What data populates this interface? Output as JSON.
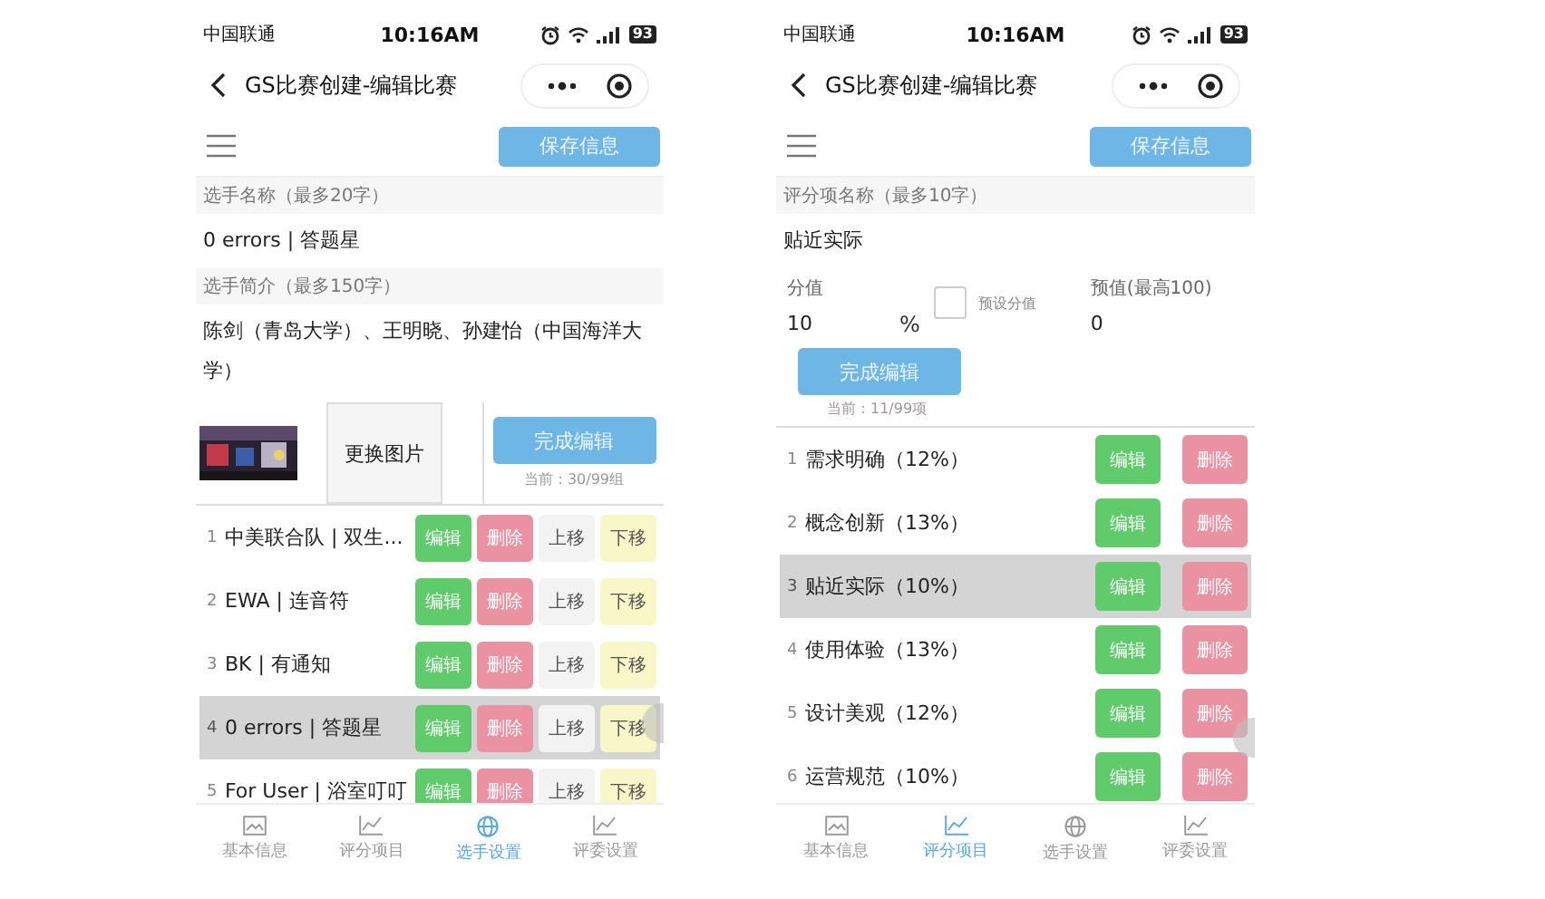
{
  "phones": [
    {
      "status": {
        "carrier": "中国联通",
        "time": "10:16AM",
        "battery": "93"
      },
      "title": "GS比赛创建-编辑比赛",
      "save_label": "保存信息",
      "form": [
        {
          "kind": "field",
          "label": "选手名称（最多20字）",
          "value": "0 errors | 答题星"
        },
        {
          "kind": "field",
          "label": "选手简介（最多150字）",
          "value": "陈剑（青岛大学）、王明晓、孙建怡（中国海洋大学）"
        },
        {
          "kind": "image_row",
          "change_label": "更换图片",
          "done_label": "完成编辑",
          "counter": "当前：30/99组"
        }
      ],
      "list": [
        {
          "index": "1",
          "text": "中美联合队 | 双生...",
          "selected": false,
          "actions": [
            {
              "kind": "edit",
              "label": "编辑"
            },
            {
              "kind": "delete",
              "label": "删除"
            },
            {
              "kind": "up",
              "label": "上移"
            },
            {
              "kind": "down",
              "label": "下移"
            }
          ]
        },
        {
          "index": "2",
          "text": "EWA | 连音符",
          "selected": false,
          "actions": [
            {
              "kind": "edit",
              "label": "编辑"
            },
            {
              "kind": "delete",
              "label": "删除"
            },
            {
              "kind": "up",
              "label": "上移"
            },
            {
              "kind": "down",
              "label": "下移"
            }
          ]
        },
        {
          "index": "3",
          "text": "BK | 有通知",
          "selected": false,
          "actions": [
            {
              "kind": "edit",
              "label": "编辑"
            },
            {
              "kind": "delete",
              "label": "删除"
            },
            {
              "kind": "up",
              "label": "上移"
            },
            {
              "kind": "down",
              "label": "下移"
            }
          ]
        },
        {
          "index": "4",
          "text": "0 errors | 答题星",
          "selected": true,
          "actions": [
            {
              "kind": "edit",
              "label": "编辑"
            },
            {
              "kind": "delete",
              "label": "删除"
            },
            {
              "kind": "up",
              "label": "上移"
            },
            {
              "kind": "down",
              "label": "下移"
            }
          ]
        },
        {
          "index": "5",
          "text": "For User | 浴室叮叮",
          "selected": false,
          "actions": [
            {
              "kind": "edit",
              "label": "编辑"
            },
            {
              "kind": "delete",
              "label": "删除"
            },
            {
              "kind": "up",
              "label": "上移"
            },
            {
              "kind": "down",
              "label": "下移"
            }
          ]
        }
      ],
      "tabs": [
        {
          "label": "基本信息",
          "selected": false
        },
        {
          "label": "评分项目",
          "selected": false
        },
        {
          "label": "选手设置",
          "selected": true
        },
        {
          "label": "评委设置",
          "selected": false
        }
      ]
    },
    {
      "status": {
        "carrier": "中国联通",
        "time": "10:16AM",
        "battery": "93"
      },
      "title": "GS比赛创建-编辑比赛",
      "save_label": "保存信息",
      "form": [
        {
          "kind": "field",
          "label": "评分项名称（最多10字）",
          "value": "贴近实际"
        },
        {
          "kind": "score_row",
          "label": "分值",
          "value": "10",
          "unit": "%",
          "checkbox_label": "预设分值",
          "checked": false,
          "preset_label": "预值(最高100)",
          "preset_value": "0"
        },
        {
          "kind": "done_row",
          "done_label": "完成编辑",
          "counter": "当前：11/99项"
        }
      ],
      "list": [
        {
          "index": "1",
          "text": "需求明确（12%）",
          "selected": false,
          "actions": [
            {
              "kind": "edit",
              "label": "编辑"
            },
            {
              "kind": "delete",
              "label": "删除"
            }
          ]
        },
        {
          "index": "2",
          "text": "概念创新（13%）",
          "selected": false,
          "actions": [
            {
              "kind": "edit",
              "label": "编辑"
            },
            {
              "kind": "delete",
              "label": "删除"
            }
          ]
        },
        {
          "index": "3",
          "text": "贴近实际（10%）",
          "selected": true,
          "actions": [
            {
              "kind": "edit",
              "label": "编辑"
            },
            {
              "kind": "delete",
              "label": "删除"
            }
          ]
        },
        {
          "index": "4",
          "text": "使用体验（13%）",
          "selected": false,
          "actions": [
            {
              "kind": "edit",
              "label": "编辑"
            },
            {
              "kind": "delete",
              "label": "删除"
            }
          ]
        },
        {
          "index": "5",
          "text": "设计美观（12%）",
          "selected": false,
          "actions": [
            {
              "kind": "edit",
              "label": "编辑"
            },
            {
              "kind": "delete",
              "label": "删除"
            }
          ]
        },
        {
          "index": "6",
          "text": "运营规范（10%）",
          "selected": false,
          "actions": [
            {
              "kind": "edit",
              "label": "编辑"
            },
            {
              "kind": "delete",
              "label": "删除"
            }
          ]
        }
      ],
      "tabs": [
        {
          "label": "基本信息",
          "selected": false
        },
        {
          "label": "评分项目",
          "selected": true
        },
        {
          "label": "选手设置",
          "selected": false
        },
        {
          "label": "评委设置",
          "selected": false
        }
      ]
    }
  ]
}
